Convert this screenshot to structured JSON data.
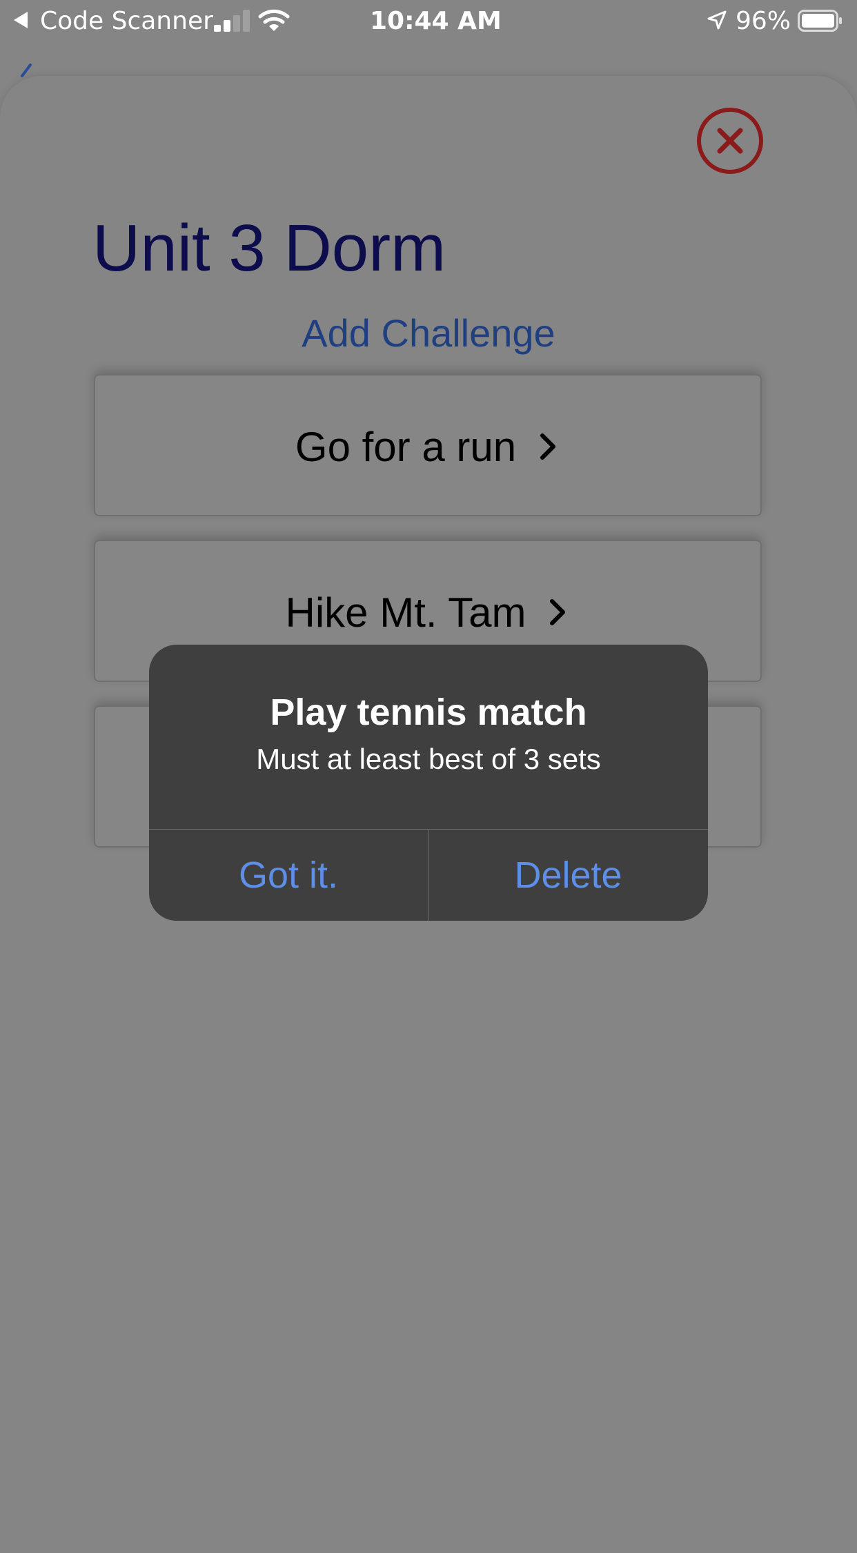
{
  "status_bar": {
    "back_app": "Code Scanner",
    "time": "10:44 AM",
    "battery": "96%"
  },
  "sheet": {
    "title": "Unit 3 Dorm",
    "add_challenge": "Add Challenge",
    "challenges": [
      {
        "label": "Go for a run"
      },
      {
        "label": "Hike Mt. Tam"
      },
      {
        "label": ""
      }
    ]
  },
  "alert": {
    "title": "Play tennis match",
    "message": "Must at least best of 3 sets",
    "buttons": [
      "Got it.",
      "Delete"
    ]
  },
  "icons": {
    "close": "close-circle-icon",
    "chevron": "chevron-right-icon",
    "signal": "cellular-signal-icon",
    "wifi": "wifi-icon",
    "location": "location-arrow-icon",
    "battery": "battery-icon"
  },
  "colors": {
    "dimmed_background": "#858585",
    "title": "#0d0d4d",
    "link": "#1f3f80",
    "close": "#8b1a1a",
    "alert_bg": "#3f3f3f",
    "alert_button": "#5d8ee8"
  }
}
